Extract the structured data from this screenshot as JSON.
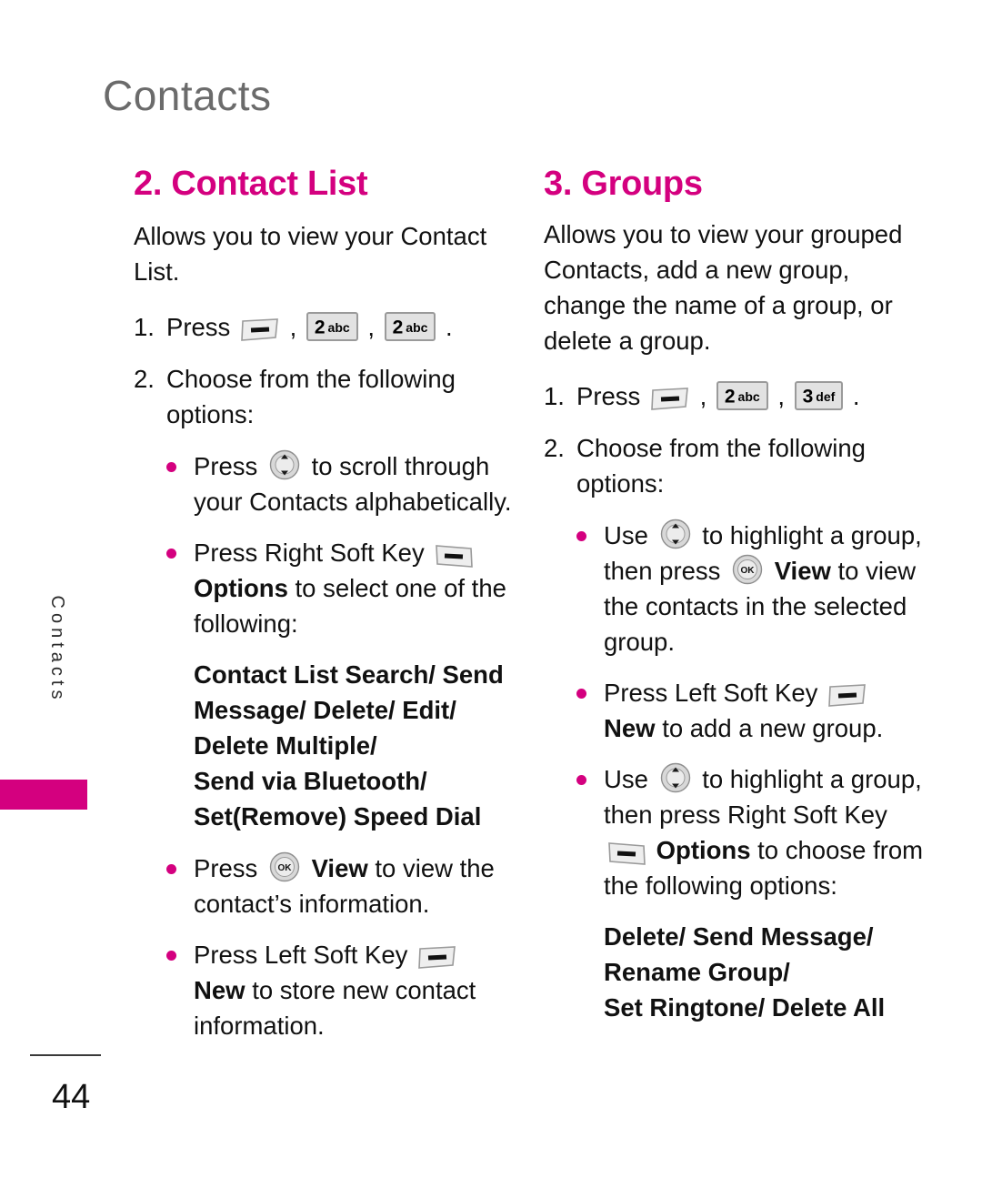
{
  "header": {
    "title": "Contacts"
  },
  "side_tab": {
    "label": "Contacts",
    "color": "#d4007f"
  },
  "footer": {
    "page_number": "44"
  },
  "theme": {
    "accent": "#d4007f",
    "header_gray": "#6b6b6b",
    "text": "#111111"
  },
  "icons": {
    "left_soft_key": "left-soft-key-icon",
    "right_soft_key": "right-soft-key-icon",
    "navigation_key": "navigation-key-icon",
    "ok_key": "ok-key-icon",
    "key_2": {
      "digit": "2",
      "letters": "abc"
    },
    "key_3": {
      "digit": "3",
      "letters": "def"
    },
    "ok_label": "OK"
  },
  "columns": {
    "left": {
      "title": "2. Contact List",
      "intro": "Allows you to view your Contact List.",
      "step1": {
        "num": "1.",
        "text": "Press"
      },
      "step1_end": ".",
      "comma": ",",
      "step2": {
        "num": "2.",
        "line1": "Choose from the following",
        "line2": "options:"
      },
      "bullets": [
        {
          "pre": "Press",
          "post": "to scroll through your Contacts alphabetically."
        },
        {
          "pre": "Press Right Soft Key",
          "bold": "Options",
          "post": "to select one of the following:"
        },
        {
          "pre": "Press",
          "bold": "View",
          "post": "to view the contact’s information."
        },
        {
          "pre": "Press Left Soft Key",
          "bold": "New",
          "post": "to store new contact information."
        }
      ],
      "options_list": [
        "Contact List Search/ Send",
        "Message/ Delete/ Edit/",
        "Delete Multiple/",
        "Send via Bluetooth/",
        "Set(Remove) Speed Dial"
      ]
    },
    "right": {
      "title": "3. Groups",
      "intro": "Allows you to view your grouped Contacts, add a new group, change the name of a group, or delete a group.",
      "step1": {
        "num": "1.",
        "text": "Press"
      },
      "step1_end": ".",
      "comma": ",",
      "step2": {
        "num": "2.",
        "line1": "Choose from the following",
        "line2": "options:"
      },
      "bullets": [
        {
          "pre": "Use",
          "mid": "to highlight a group, then press",
          "bold": "View",
          "post": "to view the contacts in the selected group."
        },
        {
          "pre": "Press Left Soft Key",
          "bold": "New",
          "post": "to add a new group."
        },
        {
          "pre": "Use",
          "mid": "to highlight a group, then press Right Soft Key",
          "bold": "Options",
          "post": "to choose from the following options:"
        }
      ],
      "options_list": [
        "Delete/ Send Message/",
        "Rename Group/",
        "Set Ringtone/ Delete All"
      ]
    }
  }
}
